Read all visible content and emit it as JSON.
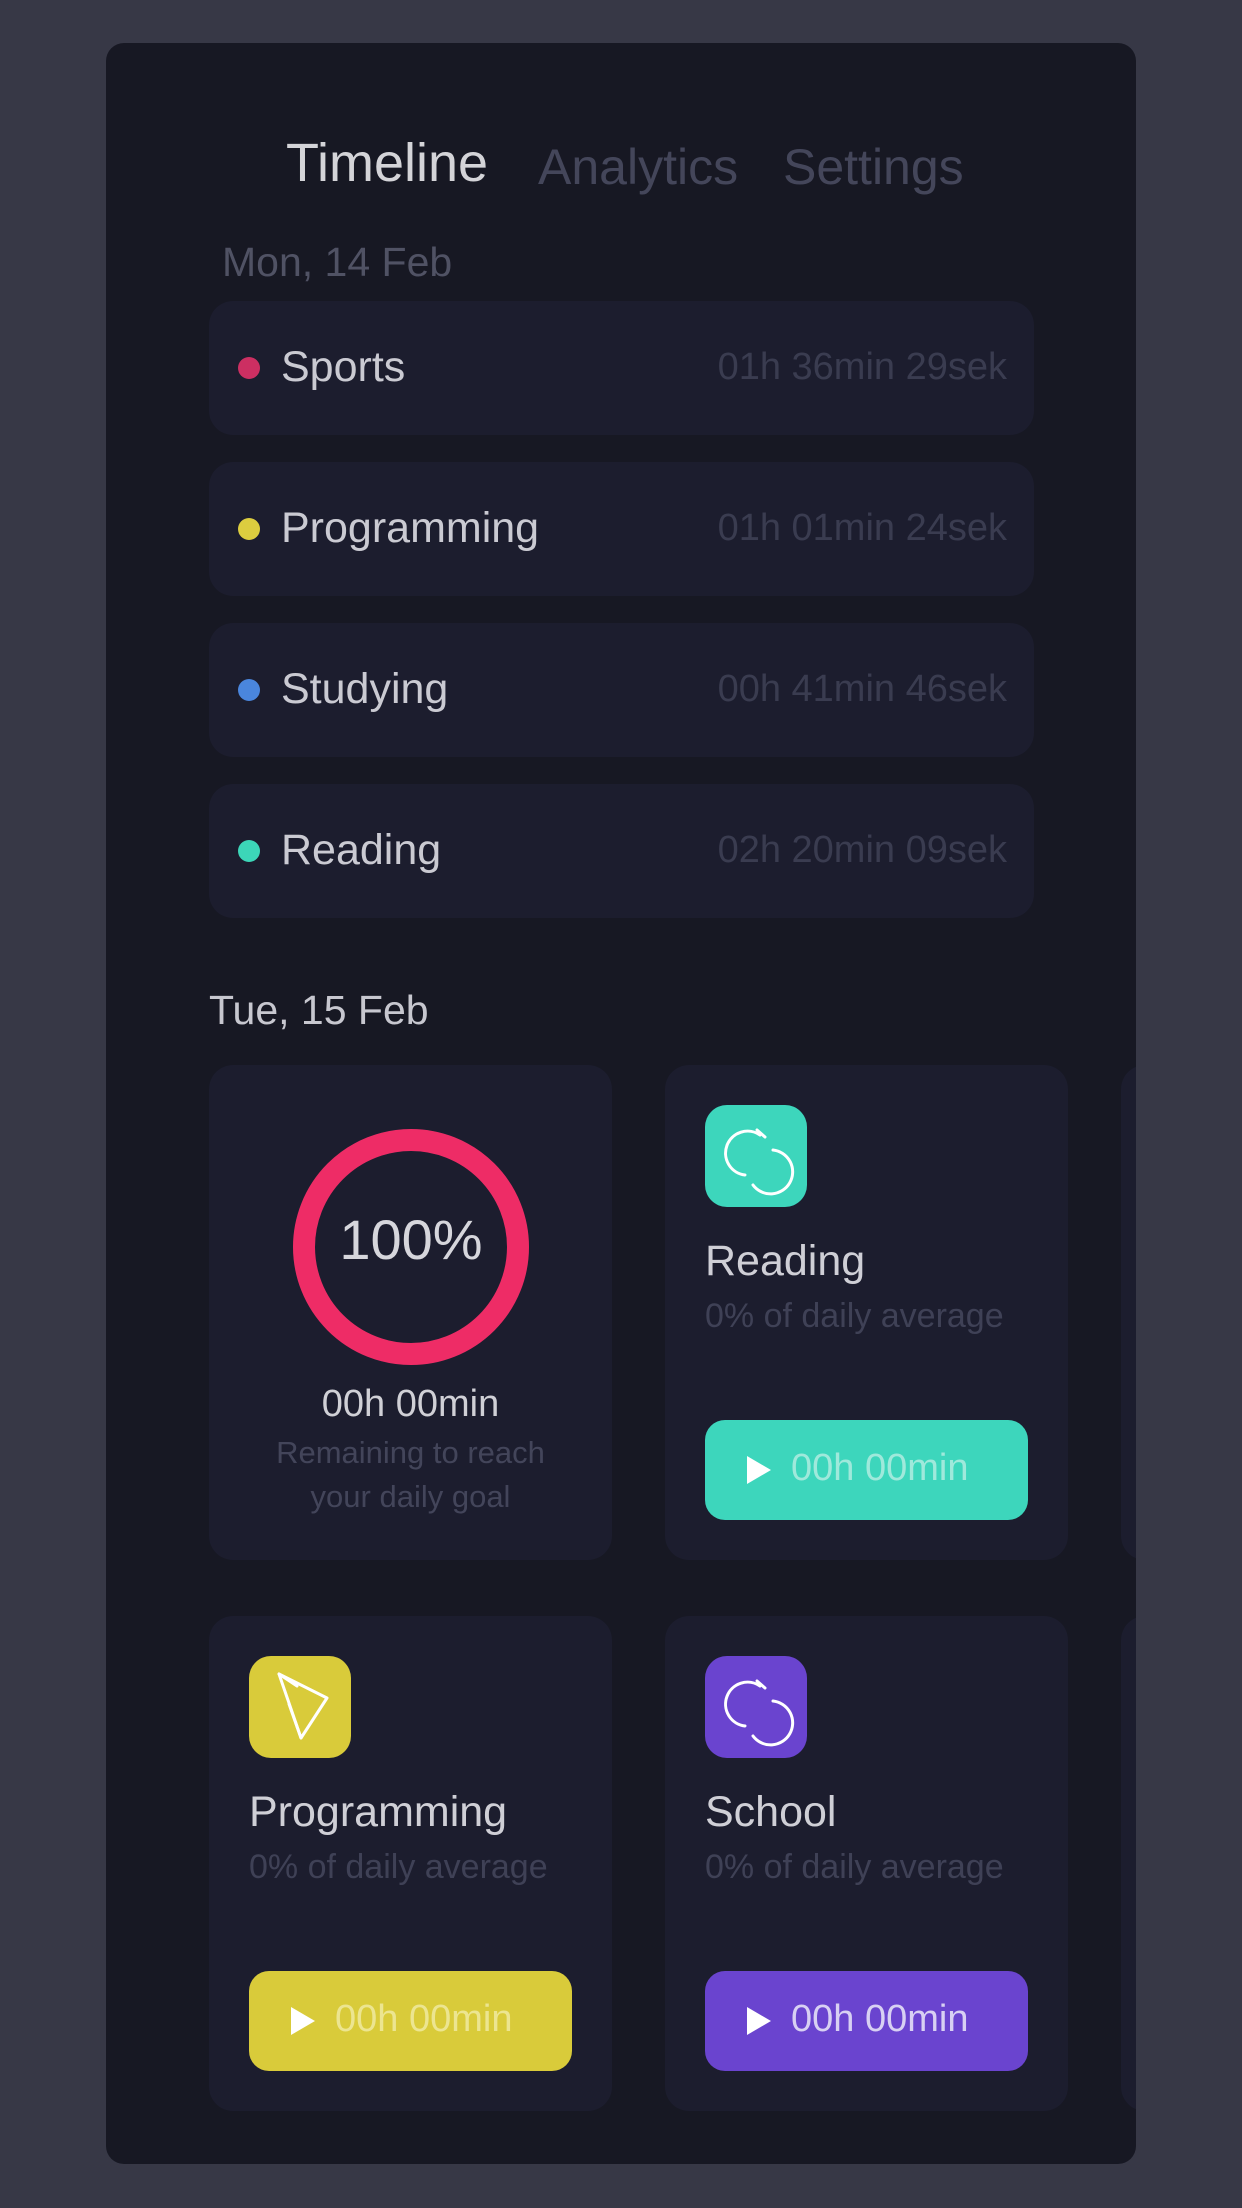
{
  "nav": {
    "tabs": [
      {
        "label": "Timeline",
        "active": true
      },
      {
        "label": "Analytics",
        "active": false
      },
      {
        "label": "Settings",
        "active": false
      }
    ]
  },
  "day1": {
    "date": "Mon, 14 Feb",
    "entries": [
      {
        "label": "Sports",
        "time": "01h 36min 29sek",
        "color": "#cc2f62"
      },
      {
        "label": "Programming",
        "time": "01h 01min 24sek",
        "color": "#dccd3f"
      },
      {
        "label": "Studying",
        "time": "00h 41min 46sek",
        "color": "#4a86dd"
      },
      {
        "label": "Reading",
        "time": "02h 20min 09sek",
        "color": "#3cd6b8"
      }
    ]
  },
  "day2": {
    "date": "Tue, 15 Feb",
    "goal": {
      "percent": "100%",
      "progress": 1.0,
      "remaining": "00h 00min",
      "caption": "Remaining to reach your daily goal",
      "ring_color": "#ee2c66"
    },
    "activities": [
      {
        "title": "Reading",
        "subtitle": "0% of daily average",
        "button_label": "00h 00min",
        "color": "#3dd6bc",
        "icon": "refresh-icon"
      },
      {
        "title": "Programming",
        "subtitle": "0% of daily average",
        "button_label": "00h 00min",
        "color": "#d9cb3a",
        "icon": "pen-icon"
      },
      {
        "title": "School",
        "subtitle": "0% of daily average",
        "button_label": "00h 00min",
        "color": "#6a44cf",
        "icon": "refresh-icon"
      }
    ]
  }
}
